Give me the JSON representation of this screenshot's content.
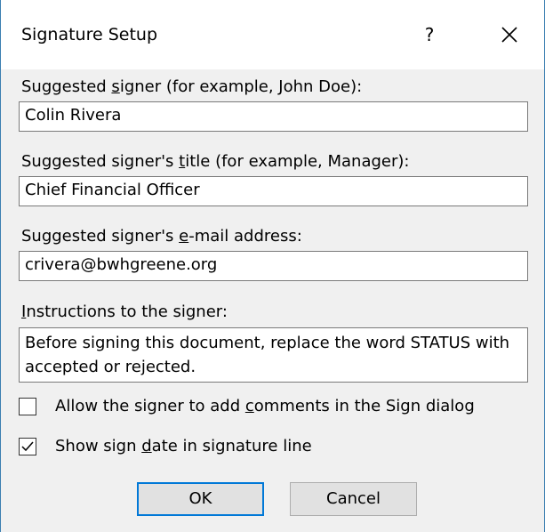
{
  "window": {
    "title": "Signature Setup",
    "help_label": "?",
    "close_icon": "close-icon"
  },
  "fields": {
    "signer_name": {
      "label_before": "Suggested ",
      "label_access": "s",
      "label_after": "igner (for example, John Doe):",
      "value": "Colin Rivera"
    },
    "signer_title": {
      "label_before": "Suggested signer's ",
      "label_access": "t",
      "label_after": "itle (for example, Manager):",
      "value": "Chief Financial Officer"
    },
    "signer_email": {
      "label_before": "Suggested signer's ",
      "label_access": "e",
      "label_after": "-mail address:",
      "value": "crivera@bwhgreene.org"
    },
    "instructions": {
      "label_before": "",
      "label_access": "I",
      "label_after": "nstructions to the signer:",
      "value": "Before signing this document, replace the word STATUS with accepted or rejected."
    }
  },
  "options": {
    "allow_comments": {
      "label_before": "Allow the signer to add ",
      "label_access": "c",
      "label_after": "omments in the Sign dialog",
      "checked": false
    },
    "show_date": {
      "label_before": "Show sign ",
      "label_access": "d",
      "label_after": "ate in signature line",
      "checked": true
    }
  },
  "buttons": {
    "ok_label": "OK",
    "cancel_label": "Cancel"
  },
  "colors": {
    "accent": "#0078d7",
    "frame_border": "#3c7fb1",
    "dialog_background": "#f0f0f0"
  }
}
